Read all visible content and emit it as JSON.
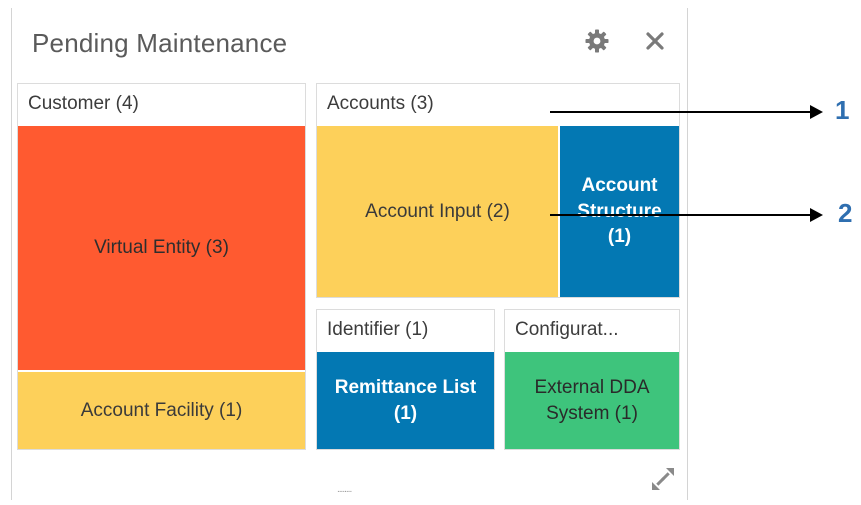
{
  "widget": {
    "title": "Pending Maintenance",
    "settings_icon": "gear-icon",
    "close_icon": "close-icon",
    "close_glyph": "✕",
    "drag_handle": "........",
    "expand_icon": "expand-icon"
  },
  "groups": {
    "customer": {
      "header": "Customer (4)",
      "tiles": {
        "virtual_entity": "Virtual Entity (3)",
        "account_facility": "Account Facility (1)"
      }
    },
    "accounts": {
      "header": "Accounts (3)",
      "tiles": {
        "account_input": "Account Input (2)",
        "account_structure_line1": "Account",
        "account_structure_line2": "Structure",
        "account_structure_count": "(1)"
      }
    },
    "identifier": {
      "header": "Identifier (1)",
      "tiles": {
        "remittance_line1": "Remittance List",
        "remittance_count": "(1)"
      }
    },
    "configuration": {
      "header": "Configurat...",
      "tiles": {
        "external_line1": "External DDA",
        "external_line2": "System (1)"
      }
    }
  },
  "callouts": {
    "one": "1",
    "two": "2"
  },
  "colors": {
    "red_tile": "#ff5a30",
    "yellow_tile": "#fdd05a",
    "blue_tile": "#0378b3",
    "green_tile": "#3ec47c",
    "callout_number": "#2f6fb0"
  }
}
